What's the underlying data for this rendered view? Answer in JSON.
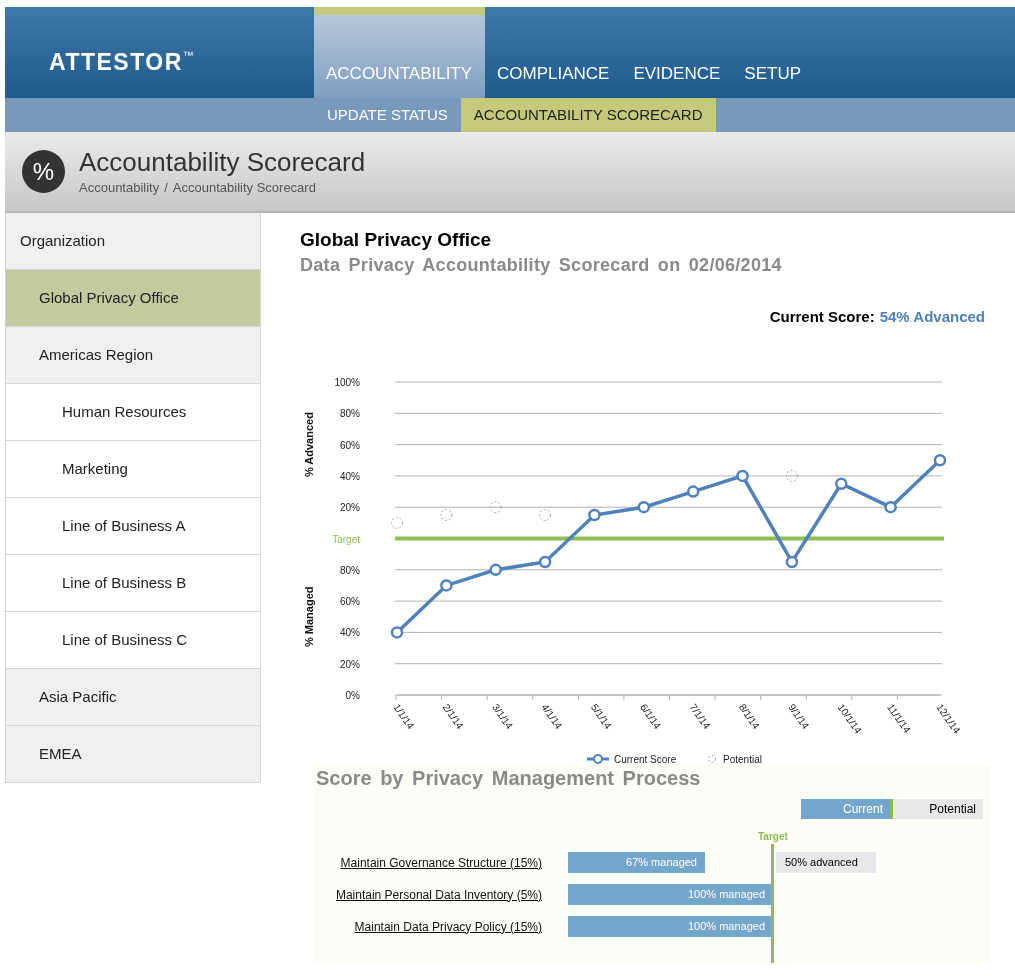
{
  "header": {
    "logo": "ATTESTOR",
    "trademark": "™",
    "nav": [
      {
        "label": "ACCOUNTABILITY",
        "selected": true
      },
      {
        "label": "COMPLIANCE",
        "selected": false
      },
      {
        "label": "EVIDENCE",
        "selected": false
      },
      {
        "label": "SETUP",
        "selected": false
      }
    ],
    "subnav": [
      {
        "label": "UPDATE STATUS",
        "selected": false
      },
      {
        "label": "ACCOUNTABILITY SCORECARD",
        "selected": true
      }
    ]
  },
  "page": {
    "icon_text": "%",
    "title": "Accountability Scorecard",
    "breadcrumb": [
      "Accountability",
      "Accountability Scorecard"
    ],
    "breadcrumb_separator": "/"
  },
  "sidebar": {
    "heading": "Organization",
    "items": [
      {
        "label": "Global Privacy Office",
        "selected": true
      },
      {
        "label": "Americas Region",
        "selected": false,
        "children": [
          {
            "label": "Human Resources",
            "selected": false
          },
          {
            "label": "Marketing",
            "selected": false
          },
          {
            "label": "Line of Business A",
            "selected": false
          },
          {
            "label": "Line of Business B",
            "selected": false
          },
          {
            "label": "Line of Business C",
            "selected": false
          }
        ]
      },
      {
        "label": "Asia Pacific",
        "selected": false
      },
      {
        "label": "EMEA",
        "selected": false
      }
    ]
  },
  "content": {
    "title": "Global Privacy Office",
    "subtitle": "Data Privacy Accountability Scorecard on 02/06/2014",
    "current_score": {
      "label": "Current Score:",
      "value": "54% Advanced"
    },
    "trend_chart": {
      "x_labels": [
        "1/1/14",
        "2/1/14",
        "3/1/14",
        "4/1/14",
        "5/1/14",
        "6/1/14",
        "7/1/14",
        "8/1/14",
        "9/1/14",
        "10/1/14",
        "11/1/14",
        "12/1/14"
      ],
      "y_labels_upper": [
        "100%",
        "80%",
        "60%",
        "40%",
        "20%"
      ],
      "target_label": "Target",
      "y_labels_lower": [
        "80%",
        "60%",
        "40%",
        "20%",
        "0%"
      ],
      "title_upper": "% Advanced",
      "title_lower": "% Managed",
      "legend": [
        {
          "kind": "line",
          "label": "Current Score"
        },
        {
          "kind": "dashed",
          "label": "Potential"
        }
      ]
    },
    "process": {
      "title": "Score by Privacy Management Process",
      "legend_current": "Current",
      "legend_potential": "Potential",
      "target_label": "Target",
      "rows": [
        {
          "label": "Maintain Governance Structure (15%)",
          "current": "67% managed",
          "potential": "50% advanced"
        },
        {
          "label": "Maintain Personal Data Inventory (5%)",
          "current": "100% managed"
        },
        {
          "label": "Maintain Data Privacy Policy (15%)",
          "current": "100% managed"
        }
      ]
    }
  }
}
